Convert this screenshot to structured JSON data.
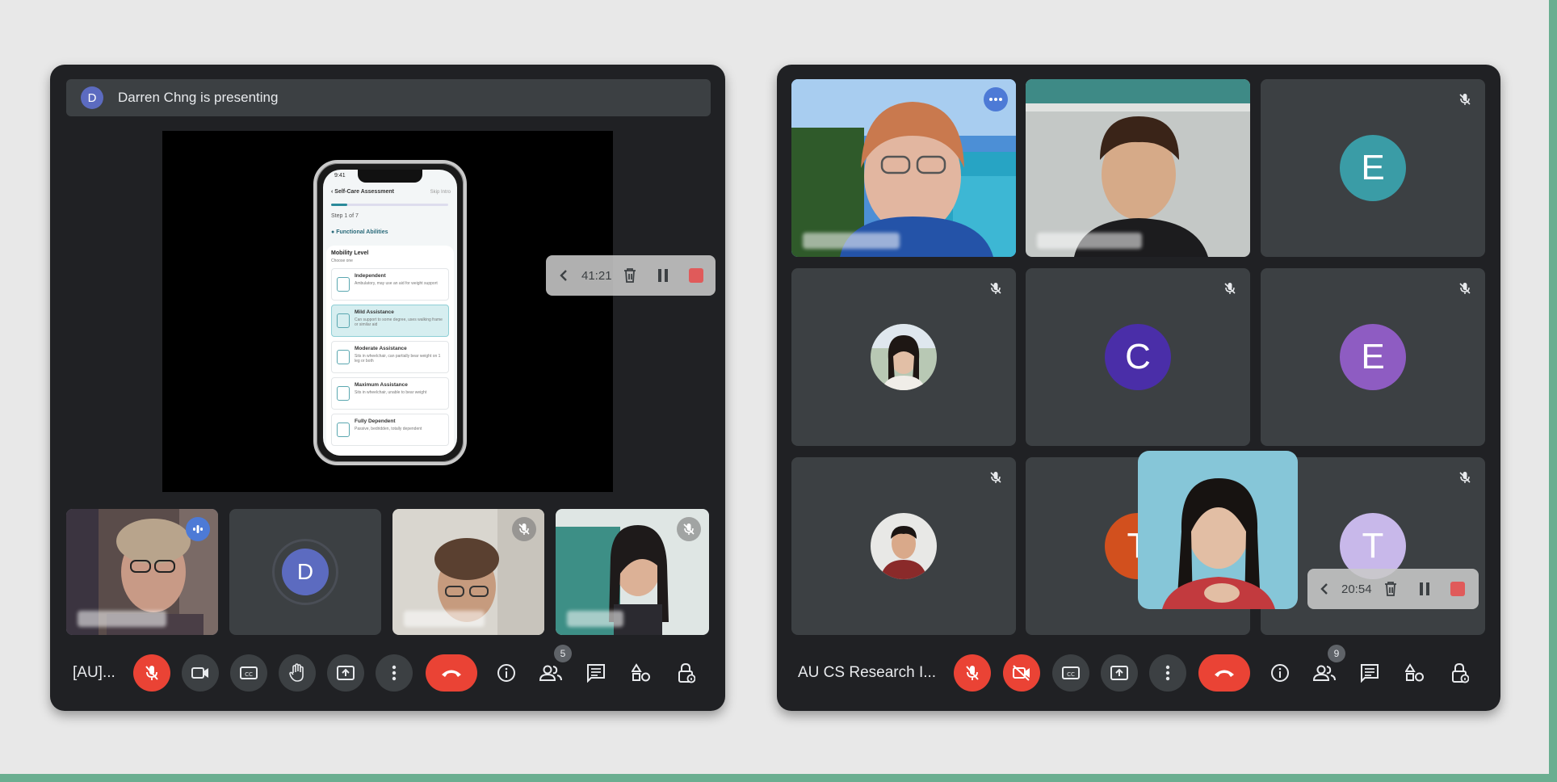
{
  "left": {
    "presenter_banner": {
      "avatar_letter": "D",
      "text": "Darren Chng is presenting"
    },
    "shared_phone": {
      "time": "9:41",
      "header": "Self-Care Assessment",
      "skip": "Skip Intro",
      "progress": 0.14,
      "step": "Step 1 of 7",
      "section": "Functional Abilities",
      "sheet_title": "Mobility Level",
      "sheet_subtitle": "Choose one",
      "options": [
        {
          "title": "Independent",
          "desc": "Ambulatory, may use an aid for weight support"
        },
        {
          "title": "Mild Assistance",
          "desc": "Can support to some degree, uses walking frame or similar aid"
        },
        {
          "title": "Moderate Assistance",
          "desc": "Sits in wheelchair, can partially bear weight on 1 leg or both"
        },
        {
          "title": "Maximum Assistance",
          "desc": "Sits in wheelchair, unable to bear weight"
        },
        {
          "title": "Fully Dependent",
          "desc": "Passive, bedridden, totally dependent"
        }
      ]
    },
    "recorder": {
      "time": "41:21"
    },
    "tiles": [
      {
        "kind": "video",
        "avatar": ""
      },
      {
        "kind": "avatar",
        "avatar": "D"
      },
      {
        "kind": "video",
        "avatar": ""
      },
      {
        "kind": "video",
        "avatar": ""
      }
    ],
    "toolbar": {
      "meeting_title": "[AU]...",
      "participants_count": "5"
    }
  },
  "right": {
    "tiles": [
      {
        "letter": ""
      },
      {
        "letter": ""
      },
      {
        "letter": "E",
        "color": "#3a9ca6"
      },
      {
        "letter": ""
      },
      {
        "letter": "C",
        "color": "#4a2ea8"
      },
      {
        "letter": "E",
        "color": "#8e5cc2"
      },
      {
        "letter": ""
      },
      {
        "letter": "T",
        "color": "#d2501e"
      },
      {
        "letter": "T",
        "color": "#c8b8ea"
      }
    ],
    "recorder": {
      "time": "20:54"
    },
    "toolbar": {
      "meeting_title": "AU CS Research I...",
      "participants_count": "9"
    }
  },
  "colors": {
    "frame": "#202124",
    "tile": "#3c4043",
    "danger": "#ea4335",
    "highlight": "#8ab4f8",
    "accent_green": "#6aae90"
  },
  "icons": [
    "mic-off-icon",
    "camera-icon",
    "camera-off-icon",
    "captions-icon",
    "raise-hand-icon",
    "present-icon",
    "more-icon",
    "end-call-icon",
    "info-icon",
    "people-icon",
    "chat-icon",
    "activities-icon",
    "lock-icon",
    "trash-icon",
    "pause-icon",
    "stop-icon",
    "chevron-left-icon",
    "speaking-icon"
  ]
}
